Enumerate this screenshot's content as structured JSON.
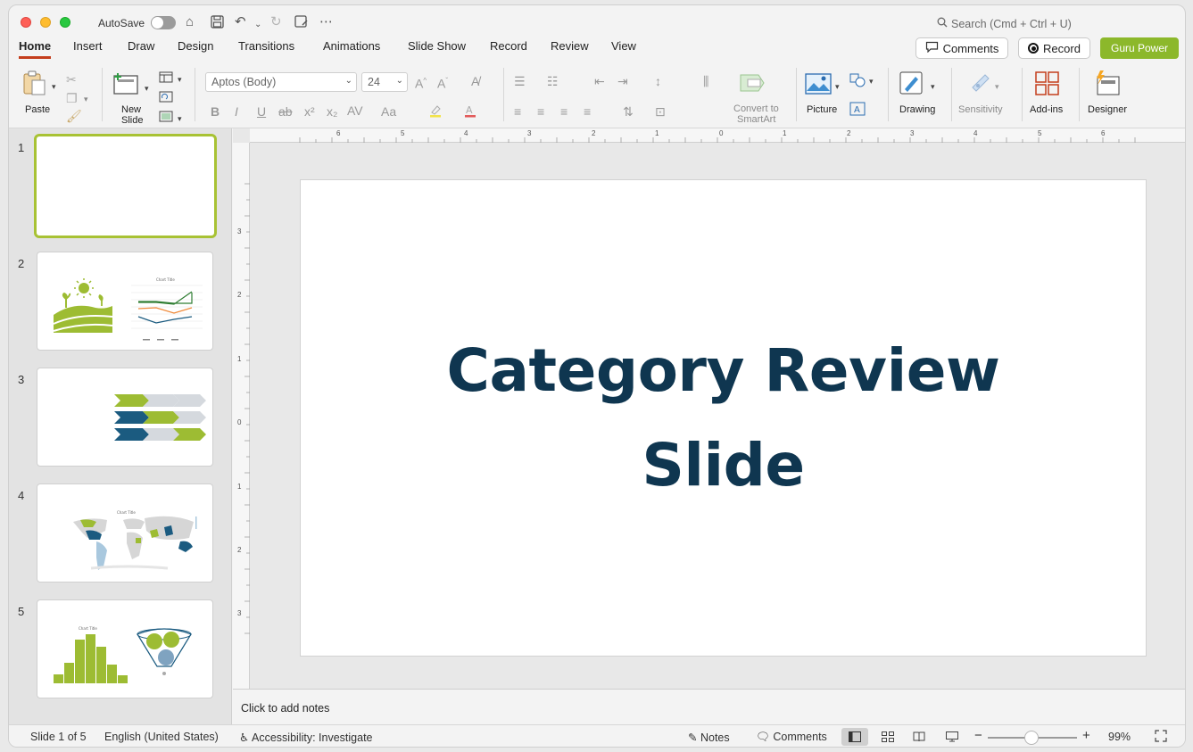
{
  "titlebar": {
    "autosave_label": "AutoSave",
    "search_placeholder": "Search (Cmd + Ctrl + U)"
  },
  "tabs": [
    {
      "label": "Home"
    },
    {
      "label": "Insert"
    },
    {
      "label": "Draw"
    },
    {
      "label": "Design"
    },
    {
      "label": "Transitions"
    },
    {
      "label": "Animations"
    },
    {
      "label": "Slide Show"
    },
    {
      "label": "Record"
    },
    {
      "label": "Review"
    },
    {
      "label": "View"
    }
  ],
  "header_buttons": {
    "comments": "Comments",
    "record": "Record",
    "guru": "Guru Power"
  },
  "ribbon": {
    "paste": "Paste",
    "new_slide_1": "New",
    "new_slide_2": "Slide",
    "font_name": "Aptos (Body)",
    "font_size": "24",
    "convert_1": "Convert to",
    "convert_2": "SmartArt",
    "picture": "Picture",
    "drawing": "Drawing",
    "sensitivity": "Sensitivity",
    "addins": "Add-ins",
    "designer": "Designer"
  },
  "thumbnails": [
    {
      "num": "1"
    },
    {
      "num": "2"
    },
    {
      "num": "3"
    },
    {
      "num": "4"
    },
    {
      "num": "5"
    }
  ],
  "thumb_text": {
    "chart_title": "Chart Title"
  },
  "slide": {
    "title_line1": "Category Review",
    "title_line2": "Slide"
  },
  "notes": {
    "placeholder": "Click to add notes"
  },
  "ruler": {
    "top": [
      "6",
      "5",
      "4",
      "3",
      "2",
      "1",
      "0",
      "1",
      "2",
      "3",
      "4",
      "5",
      "6"
    ],
    "left": [
      "3",
      "2",
      "1",
      "0",
      "1",
      "2",
      "3"
    ]
  },
  "statusbar": {
    "slide_count": "Slide 1 of 5",
    "language": "English (United States)",
    "accessibility": "Accessibility: Investigate",
    "notes": "Notes",
    "comments": "Comments",
    "zoom": "99%"
  },
  "colors": {
    "accent_tab": "#c43e1c",
    "guru": "#8cb82b",
    "title": "#0f3650",
    "thumb_green": "#9dbc33",
    "thumb_blue": "#1b5b80"
  }
}
